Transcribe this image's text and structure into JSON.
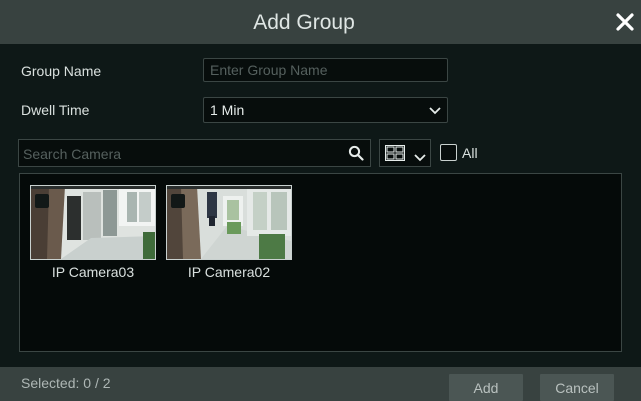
{
  "dialog": {
    "title": "Add Group"
  },
  "form": {
    "group_name_label": "Group Name",
    "group_name_placeholder": "Enter Group Name",
    "dwell_time_label": "Dwell Time",
    "dwell_time_value": "1 Min"
  },
  "search": {
    "placeholder": "Search Camera"
  },
  "filter": {
    "all_label": "All",
    "all_checked": false
  },
  "cameras": [
    {
      "name": "IP Camera03"
    },
    {
      "name": "IP Camera02"
    }
  ],
  "footer": {
    "selected_text": "Selected: 0 / 2",
    "add_label": "Add",
    "cancel_label": "Cancel"
  },
  "icons": {
    "close": "close-icon",
    "chevron": "chevron-down-icon",
    "search": "search-icon",
    "view": "view-mode-icon"
  }
}
